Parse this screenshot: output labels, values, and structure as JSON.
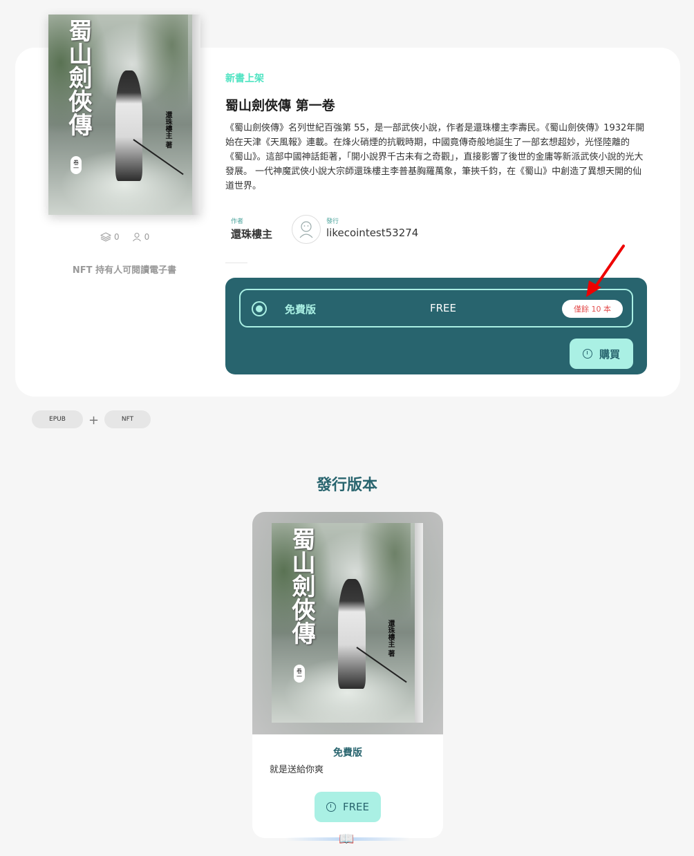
{
  "book": {
    "cover_title": "蜀山劍俠傳",
    "cover_author": "還珠樓主 著",
    "cover_volume": "卷一",
    "tag": "新書上架",
    "title": "蜀山劍俠傳 第一卷",
    "description": "《蜀山劍俠傳》名列世紀百強第 55，是一部武俠小說，作者是還珠樓主李壽民。《蜀山劍俠傳》1932年開始在天津《天風報》連載。在烽火硝煙的抗戰時期，中國竟傳奇般地誕生了一部玄想超妙，光怪陸離的《蜀山》。這部中國神話鉅著，「開小說界千古未有之奇觀」，直接影響了後世的金庸等新派武俠小說的光大發展。 一代神魔武俠小說大宗師還珠樓主李普基胸羅萬象，筆挾千鈞，在《蜀山》中創造了異想天開的仙道世界。",
    "stats": {
      "collects": "0",
      "owners": "0"
    },
    "nft_note": "NFT 持有人可閱讀電子書",
    "author_label": "作者",
    "author_name": "還珠樓主",
    "publisher_label": "發行",
    "publisher_name": "likecointest53274"
  },
  "purchase": {
    "edition_name": "免費版",
    "price": "FREE",
    "stock": "僅餘 10 本",
    "buy_label": "購買"
  },
  "formats": {
    "epub": "EPUB",
    "nft": "NFT",
    "plus": "+"
  },
  "editions_section": {
    "title": "發行版本",
    "card": {
      "name": "免費版",
      "description": "就是送給你爽",
      "button_label": "FREE"
    }
  },
  "colors": {
    "accent": "#28646e",
    "mint": "#aaf0e4",
    "tag": "#50e3c2",
    "stock": "#e35050"
  },
  "icons": [
    "layers-icon",
    "user-icon",
    "avatar-icon",
    "info-icon",
    "arrow-icon",
    "book-icon"
  ]
}
